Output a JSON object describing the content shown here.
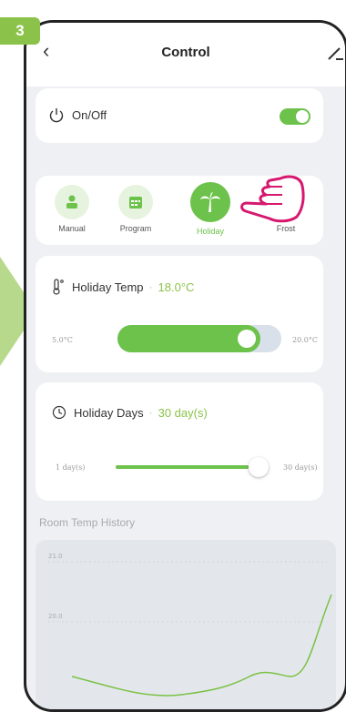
{
  "step": {
    "number": "3"
  },
  "header": {
    "title": "Control"
  },
  "power": {
    "label": "On/Off",
    "enabled": true
  },
  "modes": [
    {
      "label": "Manual",
      "icon": "person-icon",
      "active": false
    },
    {
      "label": "Program",
      "icon": "calendar-icon",
      "active": false
    },
    {
      "label": "Holiday",
      "icon": "palm-tree-icon",
      "active": true
    },
    {
      "label": "Frost",
      "icon": "snowflake-icon",
      "active": false
    }
  ],
  "holiday_temp": {
    "title": "Holiday Temp",
    "separator": "·",
    "value": "18.0°C",
    "min_label": "5.0°C",
    "max_label": "20.0°C",
    "level": 0.87
  },
  "holiday_days": {
    "title": "Holiday Days",
    "separator": "·",
    "value": "30 day(s)",
    "min_label": "1 day(s)",
    "max_label": "30 day(s)",
    "level": 1.0
  },
  "history": {
    "title": "Room Temp History",
    "y_ticks": [
      "21.0",
      "20.0"
    ]
  },
  "colors": {
    "accent": "#6cc24a",
    "step_badge": "#8bc34a",
    "hand": "#d6186f"
  }
}
